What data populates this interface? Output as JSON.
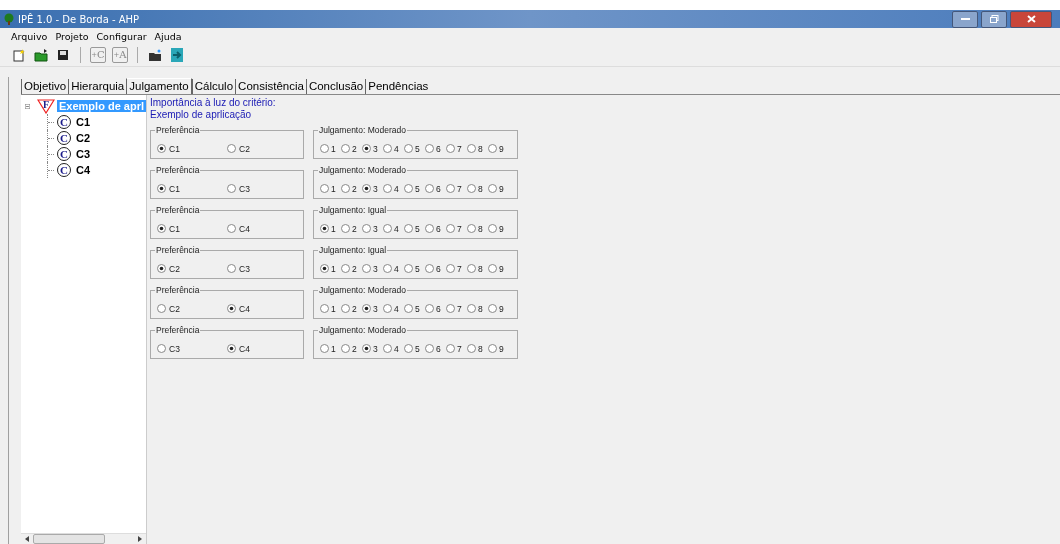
{
  "window": {
    "title": "IPÊ 1.0 - De Borda - AHP"
  },
  "menu": [
    "Arquivo",
    "Projeto",
    "Configurar",
    "Ajuda"
  ],
  "toolbar": [
    {
      "kind": "new"
    },
    {
      "kind": "open"
    },
    {
      "kind": "save"
    },
    {
      "kind": "sep"
    },
    {
      "kind": "letter",
      "text": "$^{+}$C"
    },
    {
      "kind": "letter",
      "text": "$^{+}$A"
    },
    {
      "kind": "sep"
    },
    {
      "kind": "folder"
    },
    {
      "kind": "exit"
    }
  ],
  "tabs": [
    {
      "label": "Objetivo",
      "selected": false
    },
    {
      "label": "Hierarquia",
      "selected": false
    },
    {
      "label": "Julgamento",
      "selected": true
    },
    {
      "label": "Cálculo",
      "selected": false
    },
    {
      "label": "Consistência",
      "selected": false
    },
    {
      "label": "Conclusão",
      "selected": false
    },
    {
      "label": "Pendências",
      "selected": false
    }
  ],
  "tree": {
    "label": "Exemplo de aprl",
    "badge": "F",
    "selected": true,
    "expanded": true,
    "children": [
      {
        "label": "C1",
        "badge": "C",
        "selected": false
      },
      {
        "label": "C2",
        "badge": "C",
        "selected": false
      },
      {
        "label": "C3",
        "badge": "C",
        "selected": false
      },
      {
        "label": "C4",
        "badge": "C",
        "selected": false
      }
    ]
  },
  "header": [
    "Importância à luz do critério:",
    "Exemplo de aprlicação"
  ],
  "comparisons": [
    {
      "preference": {
        "title": "Preferência",
        "options": [
          {
            "label": "C1",
            "selected": true
          },
          {
            "label": "C2",
            "selected": false
          }
        ]
      },
      "judgment": {
        "title": "Julgamento: Moderado",
        "options": [
          {
            "label": "1",
            "selected": false
          },
          {
            "label": "2",
            "selected": false
          },
          {
            "label": "3",
            "selected": true
          },
          {
            "label": "4",
            "selected": false
          },
          {
            "label": "5",
            "selected": false
          },
          {
            "label": "6",
            "selected": false
          },
          {
            "label": "7",
            "selected": false
          },
          {
            "label": "8",
            "selected": false
          },
          {
            "label": "9",
            "selected": false
          }
        ]
      }
    },
    {
      "preference": {
        "title": "Preferência",
        "options": [
          {
            "label": "C1",
            "selected": true
          },
          {
            "label": "C3",
            "selected": false
          }
        ]
      },
      "judgment": {
        "title": "Julgamento: Moderado",
        "options": [
          {
            "label": "1",
            "selected": false
          },
          {
            "label": "2",
            "selected": false
          },
          {
            "label": "3",
            "selected": true
          },
          {
            "label": "4",
            "selected": false
          },
          {
            "label": "5",
            "selected": false
          },
          {
            "label": "6",
            "selected": false
          },
          {
            "label": "7",
            "selected": false
          },
          {
            "label": "8",
            "selected": false
          },
          {
            "label": "9",
            "selected": false
          }
        ]
      }
    },
    {
      "preference": {
        "title": "Preferência",
        "options": [
          {
            "label": "C1",
            "selected": true
          },
          {
            "label": "C4",
            "selected": false
          }
        ]
      },
      "judgment": {
        "title": "Julgamento: Igual",
        "options": [
          {
            "label": "1",
            "selected": true
          },
          {
            "label": "2",
            "selected": false
          },
          {
            "label": "3",
            "selected": false
          },
          {
            "label": "4",
            "selected": false
          },
          {
            "label": "5",
            "selected": false
          },
          {
            "label": "6",
            "selected": false
          },
          {
            "label": "7",
            "selected": false
          },
          {
            "label": "8",
            "selected": false
          },
          {
            "label": "9",
            "selected": false
          }
        ]
      }
    },
    {
      "preference": {
        "title": "Preferência",
        "options": [
          {
            "label": "C2",
            "selected": true
          },
          {
            "label": "C3",
            "selected": false
          }
        ]
      },
      "judgment": {
        "title": "Julgamento: Igual",
        "options": [
          {
            "label": "1",
            "selected": true
          },
          {
            "label": "2",
            "selected": false
          },
          {
            "label": "3",
            "selected": false
          },
          {
            "label": "4",
            "selected": false
          },
          {
            "label": "5",
            "selected": false
          },
          {
            "label": "6",
            "selected": false
          },
          {
            "label": "7",
            "selected": false
          },
          {
            "label": "8",
            "selected": false
          },
          {
            "label": "9",
            "selected": false
          }
        ]
      }
    },
    {
      "preference": {
        "title": "Preferência",
        "options": [
          {
            "label": "C2",
            "selected": false
          },
          {
            "label": "C4",
            "selected": true
          }
        ]
      },
      "judgment": {
        "title": "Julgamento: Moderado",
        "options": [
          {
            "label": "1",
            "selected": false
          },
          {
            "label": "2",
            "selected": false
          },
          {
            "label": "3",
            "selected": true
          },
          {
            "label": "4",
            "selected": false
          },
          {
            "label": "5",
            "selected": false
          },
          {
            "label": "6",
            "selected": false
          },
          {
            "label": "7",
            "selected": false
          },
          {
            "label": "8",
            "selected": false
          },
          {
            "label": "9",
            "selected": false
          }
        ]
      }
    },
    {
      "preference": {
        "title": "Preferência",
        "options": [
          {
            "label": "C3",
            "selected": false
          },
          {
            "label": "C4",
            "selected": true
          }
        ]
      },
      "judgment": {
        "title": "Julgamento: Moderado",
        "options": [
          {
            "label": "1",
            "selected": false
          },
          {
            "label": "2",
            "selected": false
          },
          {
            "label": "3",
            "selected": true
          },
          {
            "label": "4",
            "selected": false
          },
          {
            "label": "5",
            "selected": false
          },
          {
            "label": "6",
            "selected": false
          },
          {
            "label": "7",
            "selected": false
          },
          {
            "label": "8",
            "selected": false
          },
          {
            "label": "9",
            "selected": false
          }
        ]
      }
    }
  ]
}
